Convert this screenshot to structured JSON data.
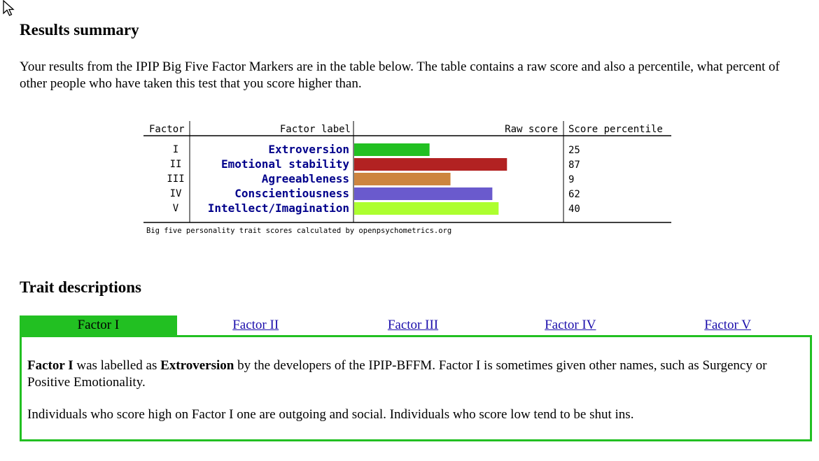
{
  "results": {
    "heading": "Results summary",
    "intro": "Your results from the IPIP Big Five Factor Markers are in the table below. The table contains a raw score and also a percentile, what percent of other people who have taken this test that you score higher than."
  },
  "chart_data": {
    "type": "bar",
    "headers": {
      "factor": "Factor",
      "label": "Factor label",
      "raw": "Raw score",
      "percentile": "Score percentile"
    },
    "factors": [
      "I",
      "II",
      "III",
      "IV",
      "V"
    ],
    "categories": [
      "Extroversion",
      "Emotional stability",
      "Agreeableness",
      "Conscientiousness",
      "Intellect/Imagination"
    ],
    "values": [
      25,
      87,
      9,
      62,
      40
    ],
    "raw_fill_fraction": [
      0.36,
      0.73,
      0.46,
      0.66,
      0.69
    ],
    "colors": [
      "#22c022",
      "#b22222",
      "#cd853f",
      "#6a5acd",
      "#adff2f"
    ],
    "footer": "Big five personality trait scores calculated by openpsychometrics.org"
  },
  "traits": {
    "heading": "Trait descriptions",
    "tabs": [
      {
        "label": "Factor I"
      },
      {
        "label": "Factor II"
      },
      {
        "label": "Factor III"
      },
      {
        "label": "Factor IV"
      },
      {
        "label": "Factor V"
      }
    ],
    "active_tab": 0,
    "panel": {
      "p1_bold1": "Factor I",
      "p1_text1": " was labelled as ",
      "p1_bold2": "Extroversion",
      "p1_text2": " by the developers of the IPIP-BFFM. Factor I is sometimes given other names, such as Surgency or Positive Emotionality.",
      "p2": "Individuals who score high on Factor I one are outgoing and social. Individuals who score low tend to be shut ins."
    }
  },
  "accent": "#22c022",
  "link_color": "#1a0dab"
}
